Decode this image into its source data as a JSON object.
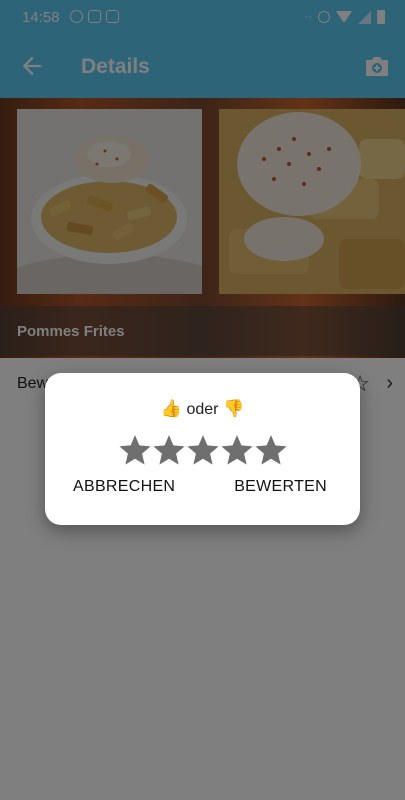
{
  "status_bar": {
    "time": "14:58",
    "left_icons": [
      "whatsapp-icon",
      "mail-icon",
      "image-icon"
    ],
    "right_icons": [
      "more-dots-icon",
      "alarm-icon",
      "wifi-icon",
      "cell-signal-icon",
      "battery-icon"
    ]
  },
  "app_bar": {
    "title": "Details",
    "back_icon": "arrow-back-icon",
    "camera_icon": "add-photo-icon",
    "color": "#5ac8f0"
  },
  "hero": {
    "caption": "Pommes Frites"
  },
  "row": {
    "label": "Bewertung",
    "stars": "★★★★☆",
    "chevron": "›"
  },
  "dialog": {
    "prompt_up": "👍",
    "prompt_text": " oder ",
    "prompt_down": "👎",
    "rating_value": 0,
    "rating_max": 5,
    "cancel_label": "ABBRECHEN",
    "confirm_label": "BEWERTEN"
  }
}
